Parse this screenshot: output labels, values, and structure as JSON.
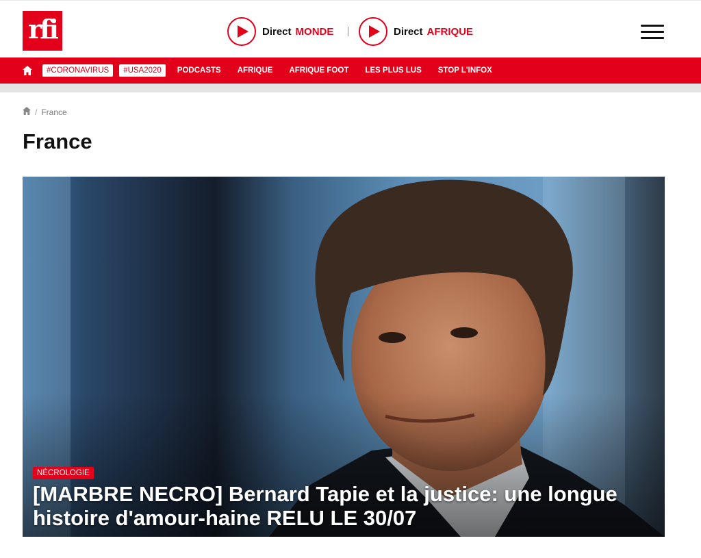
{
  "header": {
    "logo": "rfi",
    "direct": [
      {
        "label": "Direct",
        "region": "MONDE"
      },
      {
        "label": "Direct",
        "region": "AFRIQUE"
      }
    ],
    "menu_icon": "hamburger-icon"
  },
  "nav": {
    "home_icon": "home-icon",
    "tags": [
      "#CORONAVIRUS",
      "#USA2020"
    ],
    "links": [
      "PODCASTS",
      "AFRIQUE",
      "AFRIQUE FOOT",
      "LES PLUS LUS",
      "STOP L'INFOX"
    ]
  },
  "breadcrumb": {
    "home_icon": "home-icon",
    "separator": "/",
    "current": "France"
  },
  "page_title": "France",
  "hero": {
    "category": "NÉCROLOGIE",
    "title": "[MARBRE NECRO] Bernard Tapie et la justice: une longue histoire d'amour-haine RELU LE 30/07"
  },
  "colors": {
    "brand_red": "#e2001a",
    "text": "#111111"
  }
}
